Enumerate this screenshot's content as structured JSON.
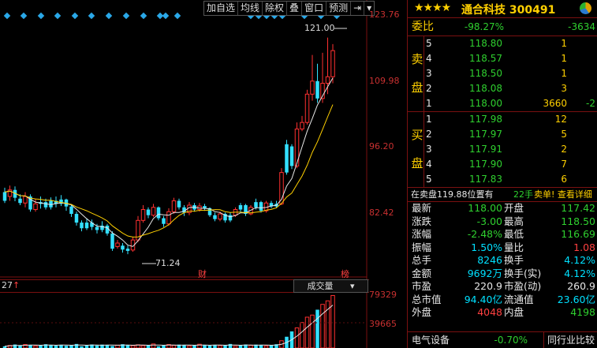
{
  "toolbar": {
    "items": [
      "加自选",
      "均线",
      "除权",
      "叠",
      "窗口",
      "预测"
    ]
  },
  "chart": {
    "y_ticks": [
      "123.76",
      "109.98",
      "96.20",
      "82.42"
    ],
    "high_annotation": "121.00",
    "low_annotation": "71.24",
    "marker_cai": "财",
    "marker_bang": "榜",
    "cursor_label": "27",
    "vol_indicator": "成交量",
    "vol_ticks": [
      "79329",
      "39665"
    ]
  },
  "chart_data": {
    "type": "candlestick",
    "ylim": [
      68,
      126
    ],
    "candles": [
      {
        "o": 83.5,
        "c": 85.5,
        "h": 86.5,
        "l": 83,
        "up": false
      },
      {
        "o": 84.5,
        "c": 86,
        "h": 87,
        "l": 83.5,
        "up": true
      },
      {
        "o": 86,
        "c": 84.2,
        "h": 86.8,
        "l": 83.4,
        "up": false
      },
      {
        "o": 84,
        "c": 83,
        "h": 85,
        "l": 82.5,
        "up": false
      },
      {
        "o": 83,
        "c": 84.5,
        "h": 85.5,
        "l": 82,
        "up": true
      },
      {
        "o": 84.5,
        "c": 81.5,
        "h": 85,
        "l": 81,
        "up": false
      },
      {
        "o": 81.5,
        "c": 82.8,
        "h": 84,
        "l": 81,
        "up": true
      },
      {
        "o": 82.8,
        "c": 83.2,
        "h": 84.5,
        "l": 81.7,
        "up": false
      },
      {
        "o": 83.2,
        "c": 82,
        "h": 84,
        "l": 81.5,
        "up": false
      },
      {
        "o": 82,
        "c": 83.5,
        "h": 84.3,
        "l": 81.5,
        "up": false
      },
      {
        "o": 83.5,
        "c": 82.8,
        "h": 84.5,
        "l": 82,
        "up": false
      },
      {
        "o": 82.8,
        "c": 83.8,
        "h": 84.8,
        "l": 82.3,
        "up": false
      },
      {
        "o": 83.8,
        "c": 82.2,
        "h": 84,
        "l": 81.2,
        "up": false
      },
      {
        "o": 82.2,
        "c": 80.5,
        "h": 82.5,
        "l": 79.8,
        "up": false
      },
      {
        "o": 80.5,
        "c": 78.5,
        "h": 81,
        "l": 77.8,
        "up": false
      },
      {
        "o": 78.5,
        "c": 77.2,
        "h": 79,
        "l": 76.5,
        "up": false
      },
      {
        "o": 77.2,
        "c": 78.5,
        "h": 79.5,
        "l": 76.8,
        "up": false
      },
      {
        "o": 78.5,
        "c": 77.5,
        "h": 79.2,
        "l": 76.8,
        "up": false
      },
      {
        "o": 77.5,
        "c": 76.8,
        "h": 78.2,
        "l": 76,
        "up": false
      },
      {
        "o": 76.8,
        "c": 77.8,
        "h": 78.8,
        "l": 76.3,
        "up": false
      },
      {
        "o": 77.8,
        "c": 76,
        "h": 78.2,
        "l": 75.5,
        "up": false
      },
      {
        "o": 76,
        "c": 72.5,
        "h": 76.5,
        "l": 72,
        "up": false
      },
      {
        "o": 73,
        "c": 73.8,
        "h": 74.5,
        "l": 72.5,
        "up": true
      },
      {
        "o": 73.2,
        "c": 72.3,
        "h": 73.8,
        "l": 71.6,
        "up": false
      },
      {
        "o": 72.5,
        "c": 72,
        "h": 73.2,
        "l": 71.24,
        "up": false
      },
      {
        "o": 72.2,
        "c": 74.5,
        "h": 75.2,
        "l": 71.8,
        "up": true
      },
      {
        "o": 74.5,
        "c": 79,
        "h": 80,
        "l": 74,
        "up": true
      },
      {
        "o": 79,
        "c": 81.5,
        "h": 82.5,
        "l": 78.5,
        "up": true
      },
      {
        "o": 81.5,
        "c": 80.2,
        "h": 82,
        "l": 79.5,
        "up": false
      },
      {
        "o": 80.2,
        "c": 82,
        "h": 82.8,
        "l": 79.8,
        "up": true
      },
      {
        "o": 82,
        "c": 79.5,
        "h": 82.2,
        "l": 79,
        "up": false
      },
      {
        "o": 79.5,
        "c": 78.2,
        "h": 80,
        "l": 77.5,
        "up": false
      },
      {
        "o": 78.2,
        "c": 81,
        "h": 81.8,
        "l": 77.8,
        "up": true
      },
      {
        "o": 81,
        "c": 83.5,
        "h": 84.2,
        "l": 80.5,
        "up": true
      },
      {
        "o": 83.5,
        "c": 82,
        "h": 84,
        "l": 81.5,
        "up": false
      },
      {
        "o": 82,
        "c": 80.8,
        "h": 82.5,
        "l": 80,
        "up": false
      },
      {
        "o": 80.8,
        "c": 82.5,
        "h": 83.2,
        "l": 80.2,
        "up": true
      },
      {
        "o": 82.5,
        "c": 81.5,
        "h": 83,
        "l": 81,
        "up": false
      },
      {
        "o": 81.5,
        "c": 82.3,
        "h": 83,
        "l": 81,
        "up": true
      },
      {
        "o": 82.3,
        "c": 81.8,
        "h": 82.8,
        "l": 81.2,
        "up": false
      },
      {
        "o": 81.8,
        "c": 80.2,
        "h": 82,
        "l": 79.8,
        "up": false
      },
      {
        "o": 80.2,
        "c": 79.3,
        "h": 80.8,
        "l": 78.8,
        "up": false
      },
      {
        "o": 79.3,
        "c": 80.5,
        "h": 81,
        "l": 78.8,
        "up": true
      },
      {
        "o": 80.5,
        "c": 79,
        "h": 80.8,
        "l": 78.5,
        "up": false
      },
      {
        "o": 79,
        "c": 80.2,
        "h": 80.8,
        "l": 78.6,
        "up": false
      },
      {
        "o": 80.2,
        "c": 81.5,
        "h": 82,
        "l": 79.8,
        "up": true
      },
      {
        "o": 81.5,
        "c": 82.5,
        "h": 83,
        "l": 81,
        "up": false
      },
      {
        "o": 82.5,
        "c": 80.5,
        "h": 82.8,
        "l": 80,
        "up": false
      },
      {
        "o": 80.5,
        "c": 82,
        "h": 82.5,
        "l": 80.2,
        "up": true
      },
      {
        "o": 82,
        "c": 83.2,
        "h": 84,
        "l": 81.5,
        "up": false
      },
      {
        "o": 83.2,
        "c": 81.2,
        "h": 83.5,
        "l": 80.8,
        "up": false
      },
      {
        "o": 81.2,
        "c": 83,
        "h": 83.5,
        "l": 80.8,
        "up": true
      },
      {
        "o": 83,
        "c": 82.2,
        "h": 83.5,
        "l": 81.8,
        "up": false
      },
      {
        "o": 82.2,
        "c": 82.8,
        "h": 83.5,
        "l": 81.8,
        "up": false
      },
      {
        "o": 82.8,
        "c": 90,
        "h": 91,
        "l": 82.5,
        "up": true
      },
      {
        "o": 90,
        "c": 96.5,
        "h": 97.5,
        "l": 89.5,
        "up": false
      },
      {
        "o": 96,
        "c": 91.5,
        "h": 96.5,
        "l": 90.8,
        "up": false
      },
      {
        "o": 91.5,
        "c": 100,
        "h": 101.5,
        "l": 91,
        "up": true
      },
      {
        "o": 100,
        "c": 101.5,
        "h": 103,
        "l": 99.5,
        "up": true
      },
      {
        "o": 101.5,
        "c": 108,
        "h": 109,
        "l": 101,
        "up": true
      },
      {
        "o": 108,
        "c": 111,
        "h": 117,
        "l": 106.5,
        "up": true
      },
      {
        "o": 111,
        "c": 107,
        "h": 115,
        "l": 106,
        "up": false
      },
      {
        "o": 107,
        "c": 110.5,
        "h": 117.5,
        "l": 106,
        "up": true
      },
      {
        "o": 110.5,
        "c": 112,
        "h": 121,
        "l": 108,
        "up": true
      },
      {
        "o": 112,
        "c": 118,
        "h": 119.5,
        "l": 110.5,
        "up": true
      }
    ],
    "volume": {
      "ylim": [
        0,
        79329
      ],
      "ticks": [
        79329,
        39665
      ]
    }
  },
  "stock": {
    "stars": "★★★★",
    "name": "通合科技",
    "code": "300491"
  },
  "weibi": {
    "label": "委比",
    "ratio": "-98.27%",
    "diff": "-3634"
  },
  "ask_label": [
    "卖",
    "盘"
  ],
  "bid_label": [
    "买",
    "盘"
  ],
  "asks": [
    {
      "level": "5",
      "price": "118.80",
      "vol": "1",
      "chg": ""
    },
    {
      "level": "4",
      "price": "118.57",
      "vol": "1",
      "chg": ""
    },
    {
      "level": "3",
      "price": "118.50",
      "vol": "1",
      "chg": ""
    },
    {
      "level": "2",
      "price": "118.08",
      "vol": "3",
      "chg": ""
    },
    {
      "level": "1",
      "price": "118.00",
      "vol": "3660",
      "chg": "-2"
    }
  ],
  "bids": [
    {
      "level": "1",
      "price": "117.98",
      "vol": "12"
    },
    {
      "level": "2",
      "price": "117.97",
      "vol": "5"
    },
    {
      "level": "3",
      "price": "117.91",
      "vol": "2"
    },
    {
      "level": "4",
      "price": "117.90",
      "vol": "7"
    },
    {
      "level": "5",
      "price": "117.83",
      "vol": "6"
    }
  ],
  "info_bar": {
    "text": "在卖盘119.88位置有",
    "qty": "22手",
    "action": "卖单! 查看详细"
  },
  "stats": [
    {
      "l1": "最新",
      "v1": "118.00",
      "c1": "grn",
      "l2": "开盘",
      "v2": "117.42",
      "c2": "grn"
    },
    {
      "l1": "涨跌",
      "v1": "-3.00",
      "c1": "grn",
      "l2": "最高",
      "v2": "118.50",
      "c2": "grn"
    },
    {
      "l1": "涨幅",
      "v1": "-2.48%",
      "c1": "grn",
      "l2": "最低",
      "v2": "116.69",
      "c2": "grn"
    },
    {
      "l1": "振幅",
      "v1": "1.50%",
      "c1": "cy",
      "l2": "量比",
      "v2": "1.08",
      "c2": "red"
    },
    {
      "l1": "总手",
      "v1": "8246",
      "c1": "cy",
      "l2": "换手",
      "v2": "4.12%",
      "c2": "cy"
    },
    {
      "l1": "金额",
      "v1": "9692万",
      "c1": "cy",
      "l2": "换手(实)",
      "v2": "4.12%",
      "c2": "cy"
    },
    {
      "l1": "市盈",
      "v1": "220.9",
      "c1": "wht",
      "l2": "市盈(动)",
      "v2": "260.9",
      "c2": "wht"
    },
    {
      "l1": "总市值",
      "v1": "94.40亿",
      "c1": "cy",
      "l2": "流通值",
      "v2": "23.60亿",
      "c2": "cy"
    },
    {
      "l1": "外盘",
      "v1": "4048",
      "c1": "red",
      "l2": "内盘",
      "v2": "4198",
      "c2": "grn"
    }
  ],
  "footer": {
    "sector": "电气设备",
    "sector_chg": "-0.70%",
    "compare": "同行业比较"
  }
}
